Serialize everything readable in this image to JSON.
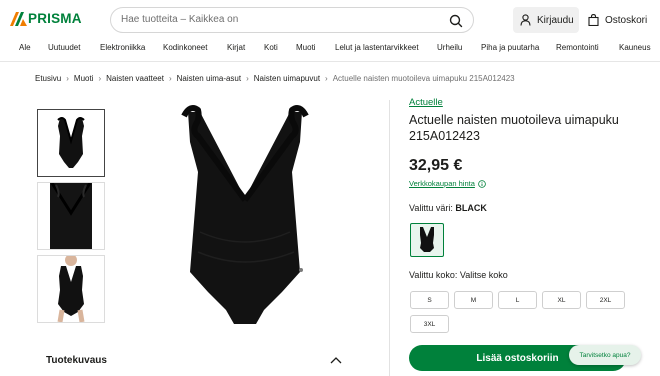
{
  "header": {
    "logo_text": "PRISMA",
    "search_placeholder": "Hae tuotteita – Kaikkea on",
    "login_label": "Kirjaudu",
    "cart_label": "Ostoskori"
  },
  "categories": [
    "Ale",
    "Uutuudet",
    "Elektroniikka",
    "Kodinkoneet",
    "Kirjat",
    "Koti",
    "Muoti",
    "Lelut ja lastentarvikkeet",
    "Urheilu",
    "Piha ja puutarha",
    "Remontointi",
    "Kauneus"
  ],
  "breadcrumb": [
    "Etusivu",
    "Muoti",
    "Naisten vaatteet",
    "Naisten uima-asut",
    "Naisten uimapuvut",
    "Actuelle naisten muotoileva uimapuku 215A012423"
  ],
  "product": {
    "brand": "Actuelle",
    "title": "Actuelle naisten muotoileva uimapuku 215A012423",
    "price": "32,95 €",
    "price_note": "Verkkokaupan hinta",
    "color_label": "Valittu väri:",
    "color_value": "BLACK",
    "size_label": "Valittu koko: Valitse koko",
    "sizes": [
      "S",
      "M",
      "L",
      "XL",
      "2XL",
      "3XL"
    ],
    "add_to_cart": "Lisää ostoskoriin",
    "help": "Tarvitsetko apua?"
  },
  "description": {
    "title": "Tuotekuvaus"
  },
  "colors": {
    "brand_green": "#00813b",
    "logo_orange": "#f07d00"
  }
}
